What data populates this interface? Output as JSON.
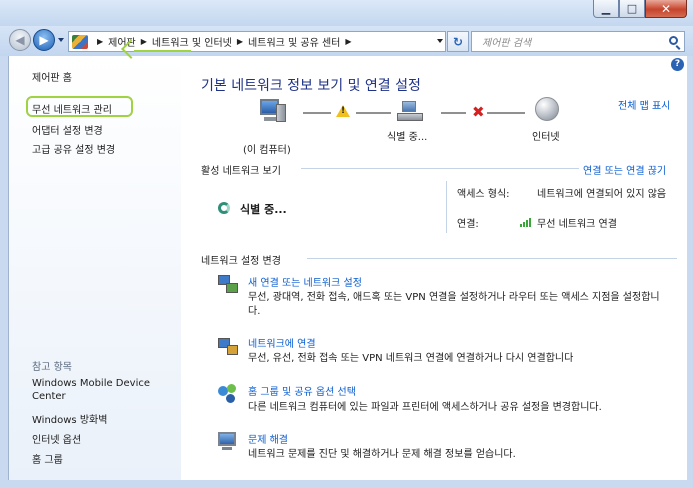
{
  "window": {
    "minimize_glyph": "▁",
    "maximize_glyph": "□",
    "close_glyph": "✕"
  },
  "nav": {
    "back_glyph": "◀",
    "forward_glyph": "▶",
    "breadcrumb": [
      "제어판",
      "네트워크 및 인터넷",
      "네트워크 및 공유 센터"
    ],
    "separator": "▶",
    "refresh_glyph": "↻",
    "search_placeholder": "제어판 검색"
  },
  "sidebar": {
    "links": [
      "제어판 홈",
      "무선 네트워크 관리",
      "어댑터 설정 변경",
      "고급 공유 설정 변경"
    ],
    "see_also_heading": "참고 항목",
    "see_also": [
      "Windows Mobile Device Center",
      "Windows 방화벽",
      "인터넷 옵션",
      "홈 그룹"
    ]
  },
  "main": {
    "help_glyph": "?",
    "title": "기본 네트워크 정보 보기 및 연결 설정",
    "full_map_link": "전체 맵 표시",
    "map": {
      "computer_label": "(이 컴퓨터)",
      "middle_label": "식별 중...",
      "internet_label": "인터넷",
      "warning_icon": "warning-icon",
      "error_glyph": "✖"
    },
    "active_section": {
      "heading": "활성 네트워크 보기",
      "connect_link": "연결 또는 연결 끊기",
      "network_status": "식별 중...",
      "access_type_label": "액세스 형식:",
      "access_type_value": "네트워크에 연결되어 있지 않음",
      "connections_label": "연결:",
      "connections_value": "무선 네트워크 연결"
    },
    "settings_section": {
      "heading": "네트워크 설정 변경",
      "tasks": [
        {
          "title": "새 연결 또는 네트워크 설정",
          "description": "무선, 광대역, 전화 접속, 애드혹 또는 VPN 연결을 설정하거나 라우터 또는 액세스 지점을 설정합니다.",
          "icon": "network-setup-icon"
        },
        {
          "title": "네트워크에 연결",
          "description": "무선, 유선, 전화 접속 또는 VPN 네트워크 연결에 연결하거나 다시 연결합니다",
          "icon": "connect-network-icon"
        },
        {
          "title": "홈 그룹 및 공유 옵션 선택",
          "description": "다른 네트워크 컴퓨터에 있는 파일과 프린터에 액세스하거나 공유 설정을 변경합니다.",
          "icon": "homegroup-icon"
        },
        {
          "title": "문제 해결",
          "description": "네트워크 문제를 진단 및 해결하거나 문제 해결 정보를 얻습니다.",
          "icon": "troubleshoot-icon"
        }
      ]
    }
  },
  "colors": {
    "link": "#0b5ed1",
    "title": "#1e3287",
    "highlight": "#9ed341",
    "chrome": "#c9daf0"
  }
}
